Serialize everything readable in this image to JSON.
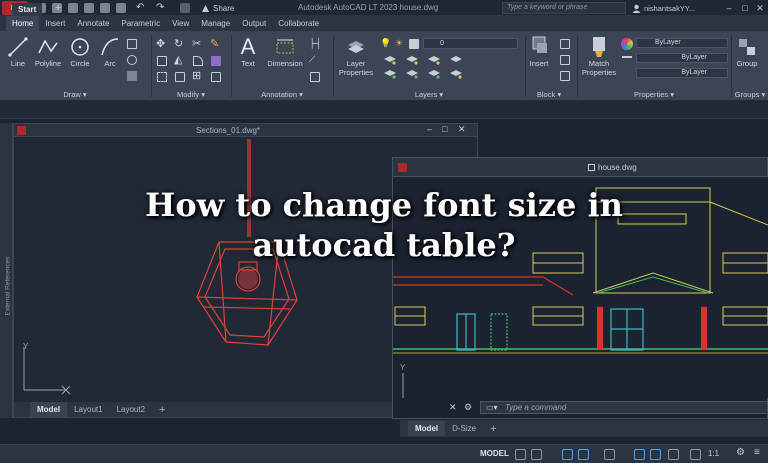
{
  "colors": {
    "accent": "#b3262c",
    "ribbon_bg": "#3b4556",
    "canvas_bg": "#212936",
    "overlay_text": "#ffffff",
    "lamp_red": "#e0403a",
    "house_yellow": "#d9c95a",
    "house_green": "#3fbf5a",
    "house_cyan": "#3fb7c8",
    "house_red": "#d8342c"
  },
  "titlebar": {
    "app_badge": "LT",
    "share_label": "Share",
    "doc_title": "Autodesk AutoCAD LT 2023   house.dwg",
    "search_placeholder": "Type a keyword or phrase",
    "user_name": "nishantsakYY...",
    "minimize": "–",
    "maximize": "□",
    "close": "✕"
  },
  "ribbon_tabs": [
    "Home",
    "Insert",
    "Annotate",
    "Parametric",
    "View",
    "Manage",
    "Output",
    "Collaborate"
  ],
  "ribbon": {
    "draw": {
      "title": "Draw ▾",
      "tools": [
        "Line",
        "Polyline",
        "Circle",
        "Arc"
      ]
    },
    "modify": {
      "title": "Modify ▾"
    },
    "annotation": {
      "title": "Annotation ▾",
      "tools": [
        "Text",
        "Dimension"
      ]
    },
    "layers": {
      "title": "Layers ▾",
      "tool": "Layer Properties",
      "current_layer": "0"
    },
    "block": {
      "title": "Block ▾",
      "tool": "Insert"
    },
    "properties": {
      "title": "Properties ▾",
      "tool": "Match Properties",
      "combo1": "ByLayer",
      "combo2": "ByLayer",
      "combo3": "ByLayer"
    },
    "groups": {
      "title": "Groups ▾",
      "tool": "Group"
    }
  },
  "filetabs": {
    "start": "Start",
    "plus": "+"
  },
  "left_window": {
    "title": "Sections_01.dwg*",
    "tabs": [
      "Model",
      "Layout1",
      "Layout2",
      "+"
    ],
    "side_label": "External References",
    "axis_y": "Y"
  },
  "right_window": {
    "title": "house.dwg",
    "tabs": [
      "Model",
      "D-Size",
      "+"
    ],
    "axis_y": "Y",
    "command_placeholder": "Type a command"
  },
  "statusbar": {
    "model": "MODEL",
    "scale": "1:1"
  },
  "overlay": {
    "line1": "How to change font size in",
    "line2": "autocad table?"
  }
}
